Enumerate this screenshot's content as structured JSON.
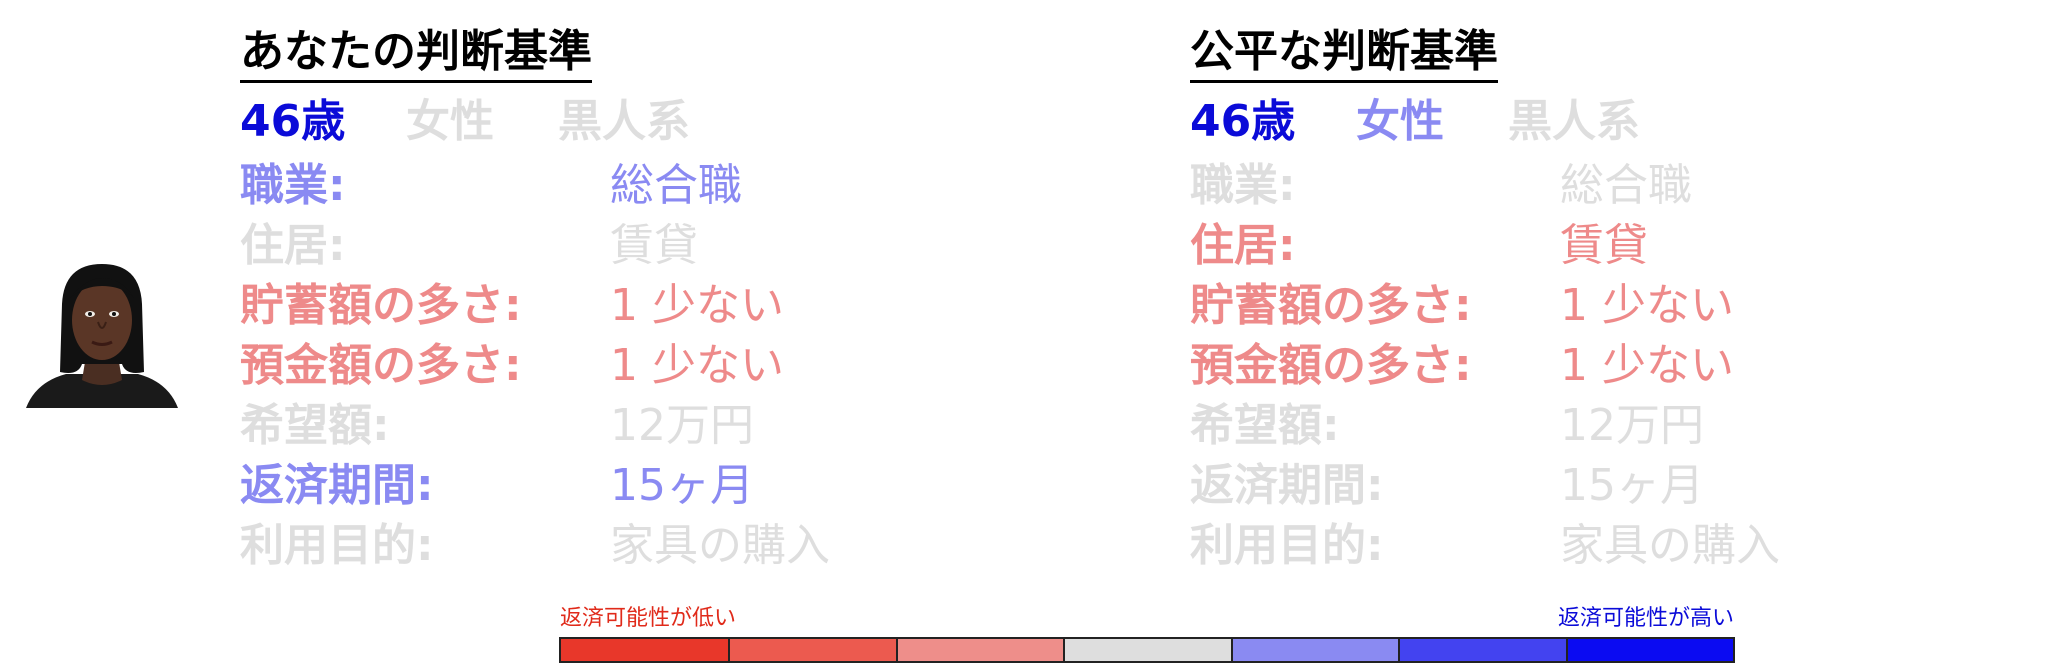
{
  "left_panel": {
    "title": "あなたの判断基準",
    "demographics": [
      {
        "text": "46歳",
        "color": "#0b0bd8"
      },
      {
        "text": "女性",
        "color": "#dedede"
      },
      {
        "text": "黒人系",
        "color": "#dedede"
      }
    ],
    "rows": [
      {
        "label": "職業:",
        "value": "総合職",
        "color": "#8a8af2"
      },
      {
        "label": "住居:",
        "value": "賃貸",
        "color": "#dedede"
      },
      {
        "label": "貯蓄額の多さ:",
        "value": "1 少ない",
        "color": "#ee8a8a"
      },
      {
        "label": "預金額の多さ:",
        "value": "1 少ない",
        "color": "#ee8a8a"
      },
      {
        "label": "希望額:",
        "value": "12万円",
        "color": "#dedede"
      },
      {
        "label": "返済期間:",
        "value": "15ヶ月",
        "color": "#8a8af2"
      },
      {
        "label": "利用目的:",
        "value": "家具の購入",
        "color": "#dedede"
      }
    ]
  },
  "right_panel": {
    "title": "公平な判断基準",
    "demographics": [
      {
        "text": "46歳",
        "color": "#0b0bd8"
      },
      {
        "text": "女性",
        "color": "#8a8af2"
      },
      {
        "text": "黒人系",
        "color": "#dedede"
      }
    ],
    "rows": [
      {
        "label": "職業:",
        "value": "総合職",
        "color": "#dedede"
      },
      {
        "label": "住居:",
        "value": "賃貸",
        "color": "#ee8a8a"
      },
      {
        "label": "貯蓄額の多さ:",
        "value": "1 少ない",
        "color": "#ee8a8a"
      },
      {
        "label": "預金額の多さ:",
        "value": "1 少ない",
        "color": "#ee8a8a"
      },
      {
        "label": "希望額:",
        "value": "12万円",
        "color": "#dedede"
      },
      {
        "label": "返済期間:",
        "value": "15ヶ月",
        "color": "#dedede"
      },
      {
        "label": "利用目的:",
        "value": "家具の購入",
        "color": "#dedede"
      }
    ]
  },
  "legend": {
    "low_label": "返済可能性が低い",
    "high_label": "返済可能性が高い",
    "low_color": "#e02a1a",
    "high_color": "#0b0bd8",
    "scale_colors": [
      "#e8372a",
      "#ec5a4f",
      "#ee8e8a",
      "#dedede",
      "#8a8af2",
      "#4343f0",
      "#0b0bf2"
    ]
  },
  "avatar": {
    "icon": "person-face-icon"
  }
}
